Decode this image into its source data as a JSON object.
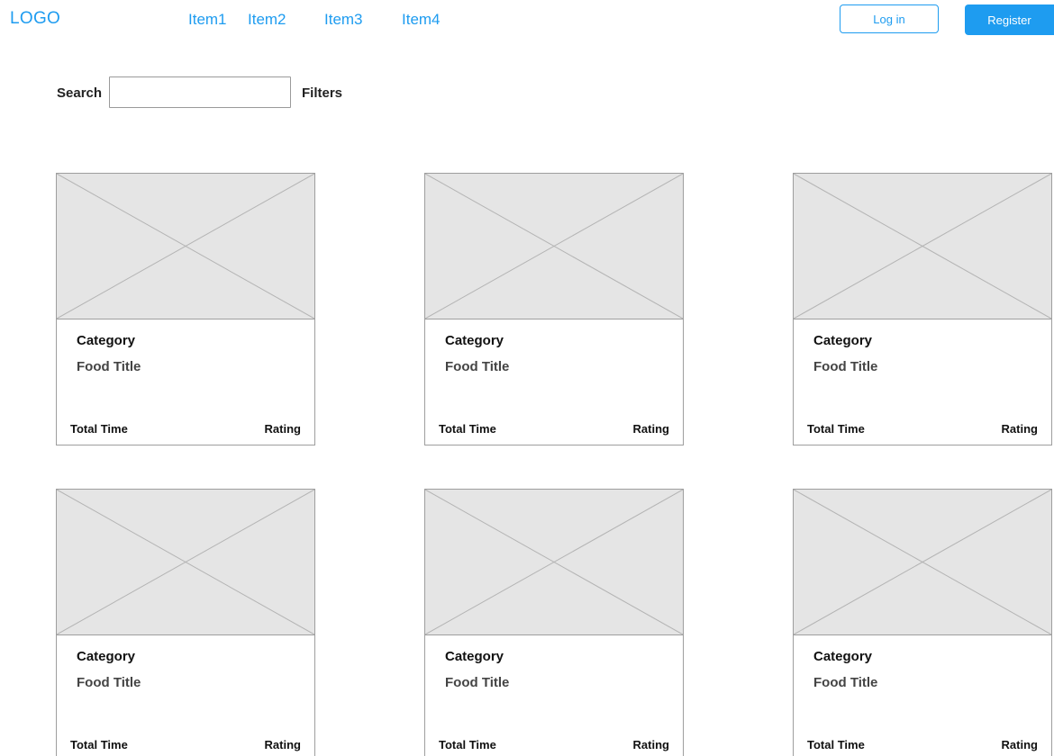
{
  "header": {
    "logo": "LOGO",
    "nav": [
      {
        "label": "Item1"
      },
      {
        "label": "Item2"
      },
      {
        "label": "Item3"
      },
      {
        "label": "Item4"
      }
    ],
    "login_label": "Log in",
    "register_label": "Register"
  },
  "search": {
    "label": "Search",
    "value": "",
    "placeholder": "",
    "filters_label": "Filters"
  },
  "cards": [
    {
      "category": "Category",
      "title": "Food Title",
      "time_label": "Total Time",
      "rating_label": "Rating"
    },
    {
      "category": "Category",
      "title": "Food Title",
      "time_label": "Total Time",
      "rating_label": "Rating"
    },
    {
      "category": "Category",
      "title": "Food Title",
      "time_label": "Total Time",
      "rating_label": "Rating"
    },
    {
      "category": "Category",
      "title": "Food Title",
      "time_label": "Total Time",
      "rating_label": "Rating"
    },
    {
      "category": "Category",
      "title": "Food Title",
      "time_label": "Total Time",
      "rating_label": "Rating"
    },
    {
      "category": "Category",
      "title": "Food Title",
      "time_label": "Total Time",
      "rating_label": "Rating"
    }
  ],
  "colors": {
    "accent": "#1e9cf0",
    "placeholder_fill": "#e5e5e5",
    "border": "#9e9e9e"
  },
  "icons": {
    "card_image": "image-placeholder-icon"
  }
}
